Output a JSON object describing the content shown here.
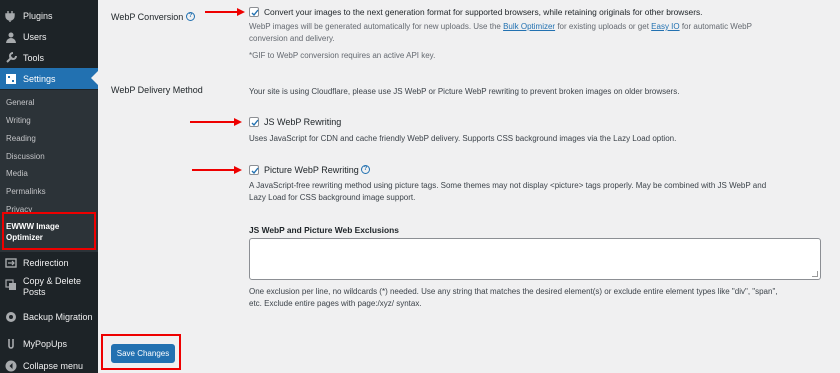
{
  "sidebar": {
    "menu": {
      "plugins": "Plugins",
      "users": "Users",
      "tools": "Tools",
      "settings": "Settings",
      "redirection": "Redirection",
      "copy_delete_line1": "Copy & Delete",
      "copy_delete_line2": "Posts",
      "backup_migration": "Backup Migration",
      "mypopups": "MyPopUps",
      "collapse": "Collapse menu"
    },
    "submenu": {
      "general": "General",
      "writing": "Writing",
      "reading": "Reading",
      "discussion": "Discussion",
      "media": "Media",
      "permalinks": "Permalinks",
      "privacy": "Privacy",
      "ewww_line1": "EWWW Image",
      "ewww_line2": "Optimizer"
    }
  },
  "webp_conversion": {
    "label": "WebP Conversion",
    "checkbox_label": "Convert your images to the next generation format for supported browsers, while retaining originals for other browsers.",
    "desc_part1": "WebP images will be generated automatically for new uploads. Use the ",
    "bulk_link": "Bulk Optimizer",
    "desc_part2": " for existing uploads or get ",
    "easy_link": "Easy IO",
    "desc_part3": " for automatic WebP",
    "desc_line2": "conversion and delivery.",
    "note": "*GIF to WebP conversion requires an active API key."
  },
  "webp_delivery": {
    "label": "WebP Delivery Method",
    "cloudflare_note": "Your site is using Cloudflare, please use JS WebP or Picture WebP rewriting to prevent broken images on older browsers.",
    "js_label": "JS WebP Rewriting",
    "js_desc": "Uses JavaScript for CDN and cache friendly WebP delivery. Supports CSS background images via the Lazy Load option.",
    "picture_label": "Picture WebP Rewriting",
    "picture_desc_line1": "A JavaScript-free rewriting method using picture tags. Some themes may not display <picture> tags properly. May be combined with JS WebP and",
    "picture_desc_line2": "Lazy Load for CSS background image support.",
    "exclusions_label": "JS WebP and Picture Web Exclusions",
    "exclusions_value": "",
    "exclusions_desc_line1": "One exclusion per line, no wildcards (*) needed. Use any string that matches the desired element(s) or exclude entire element types like \"div\", \"span\",",
    "exclusions_desc_line2": "etc. Exclude entire pages with page:/xyz/ syntax."
  },
  "save_button": "Save Changes",
  "colors": {
    "sidebar_bg": "#1d2327",
    "accent": "#2271b1",
    "annotation_red": "#e00000"
  }
}
